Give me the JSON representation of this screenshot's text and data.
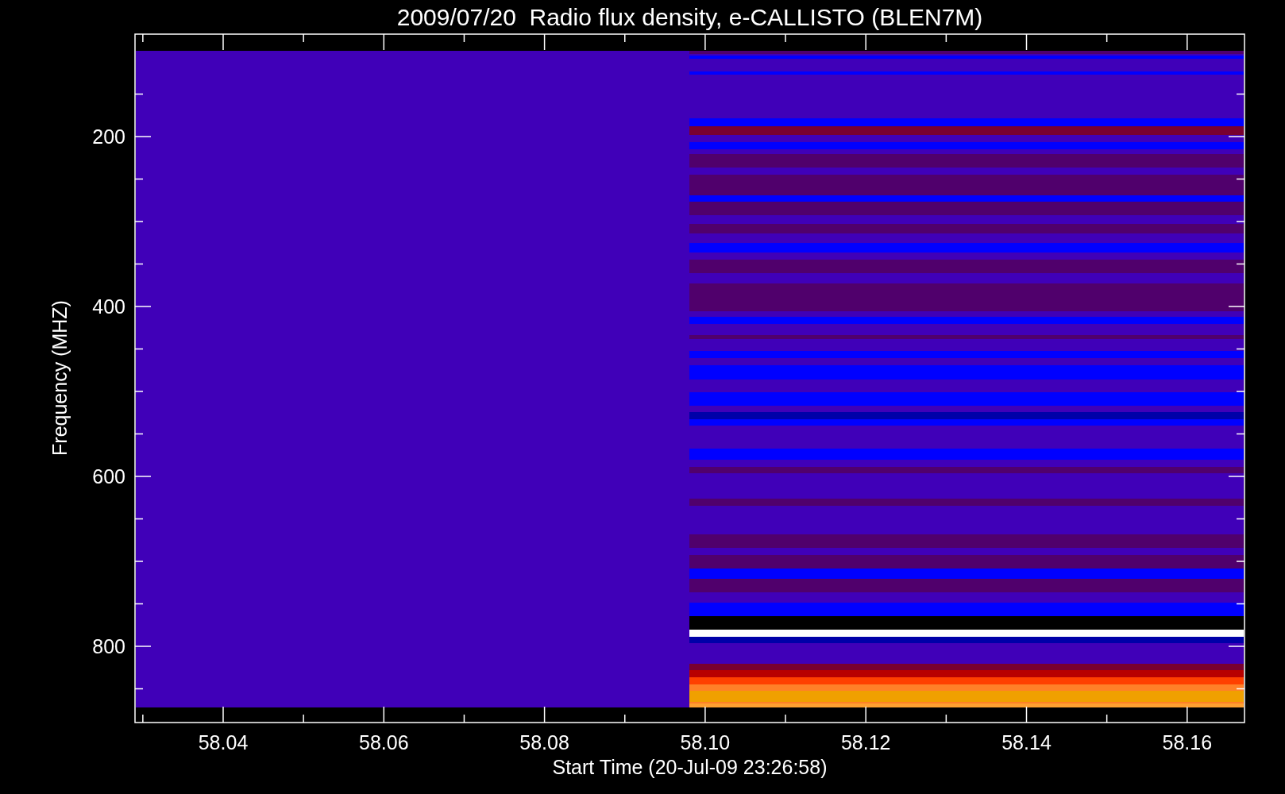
{
  "plot": {
    "title": "2009/07/20  Radio flux density, e-CALLISTO (BLEN7M)",
    "xlabel": "Start Time (20-Jul-09 23:26:58)",
    "ylabel": "Frequency (MHZ)",
    "yticks": [
      {
        "label": "200"
      },
      {
        "label": "400"
      },
      {
        "label": "600"
      },
      {
        "label": "800"
      }
    ],
    "xticks": [
      {
        "label": "58.04"
      },
      {
        "label": "58.06"
      },
      {
        "label": "58.08"
      },
      {
        "label": "58.10"
      },
      {
        "label": "58.12"
      },
      {
        "label": "58.14"
      },
      {
        "label": "58.16"
      }
    ]
  }
}
